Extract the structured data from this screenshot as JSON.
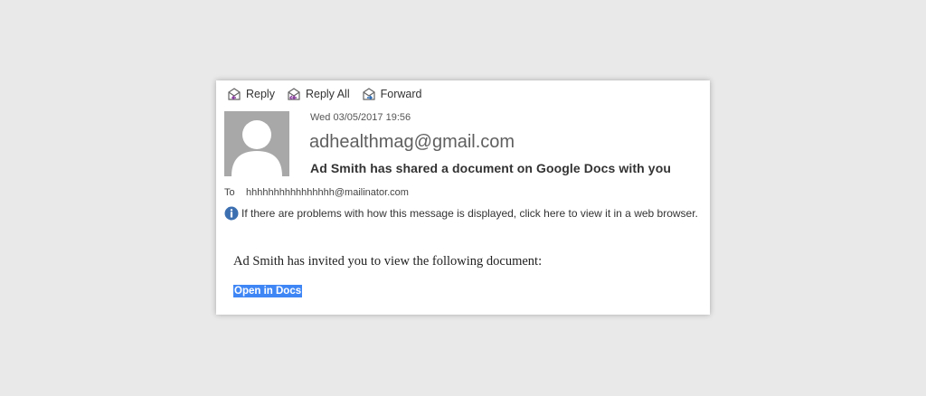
{
  "toolbar": {
    "reply_label": "Reply",
    "reply_all_label": "Reply All",
    "forward_label": "Forward",
    "reply_icon": "reply-icon",
    "reply_all_icon": "reply-all-icon",
    "forward_icon": "forward-icon"
  },
  "message": {
    "date": "Wed 03/05/2017 19:56",
    "sender": "adhealthmag@gmail.com",
    "subject": "Ad Smith has shared a document on Google Docs with you",
    "to_label": "To",
    "to_value": "hhhhhhhhhhhhhhhh@mailinator.com",
    "info_text": "If there are problems with how this message is displayed, click here to view it in a web browser.",
    "info_icon": "info-icon",
    "avatar_icon": "person-avatar-icon"
  },
  "body": {
    "text": "Ad Smith has invited you to view the following document:",
    "link_label": "Open in Docs"
  },
  "colors": {
    "background": "#e9e9e9",
    "card": "#ffffff",
    "link_highlight": "#3f86f5",
    "info_blue": "#3c6fb0",
    "avatar_gray": "#a8a8a8"
  }
}
